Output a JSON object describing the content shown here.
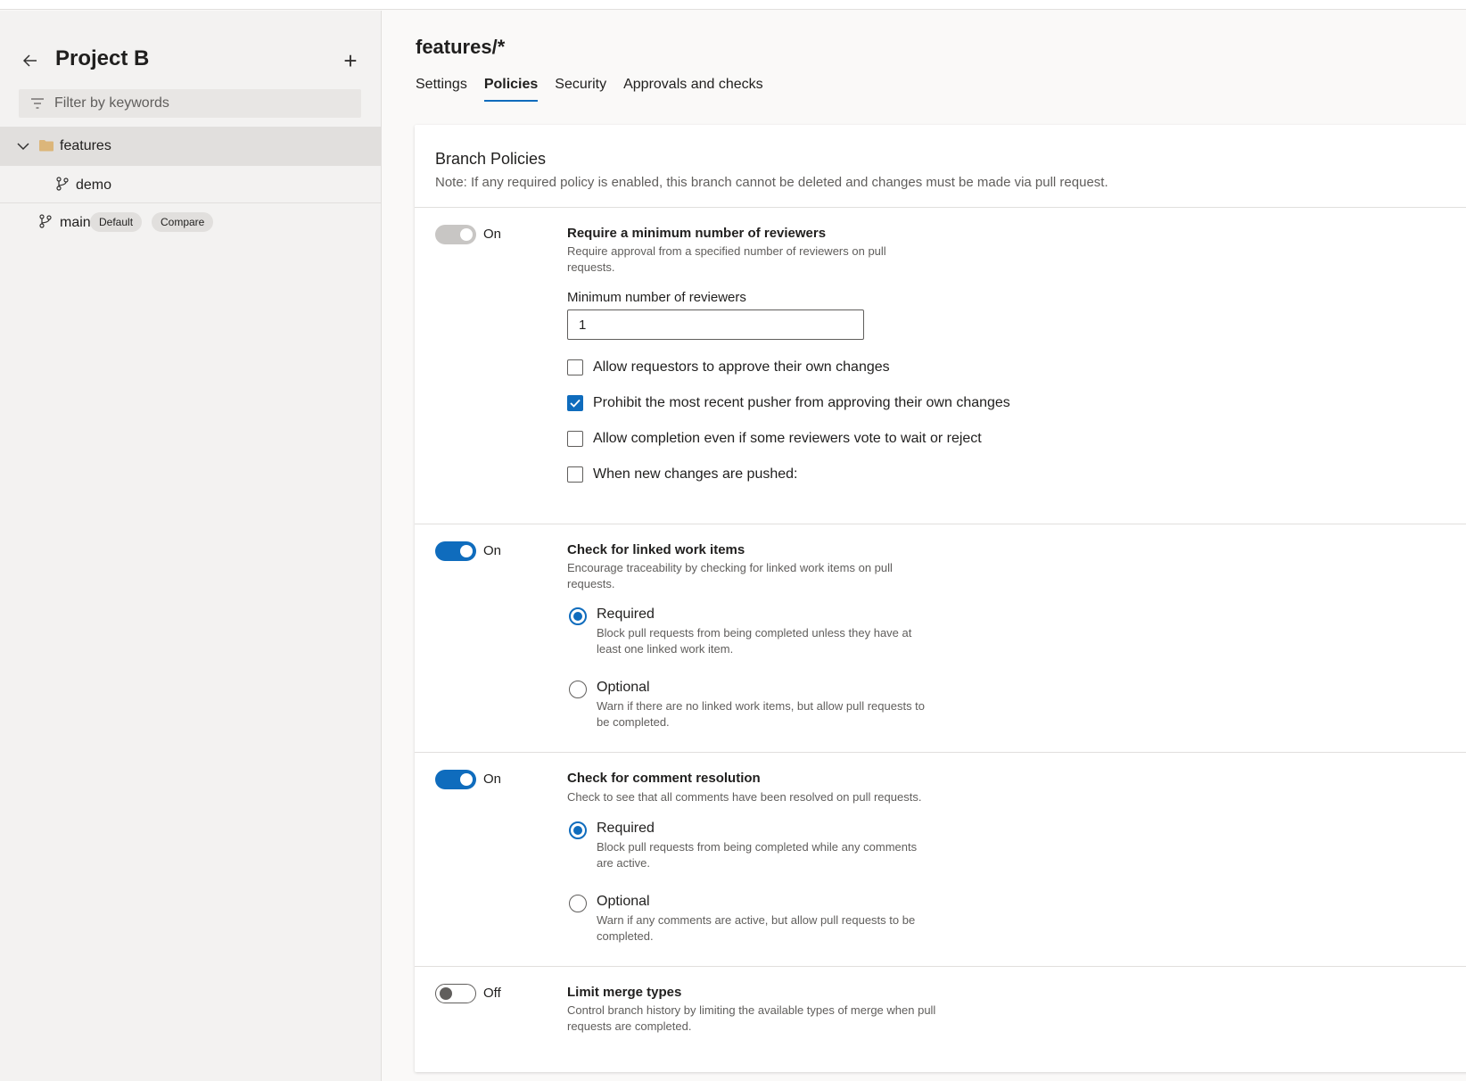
{
  "sidebar": {
    "project_title": "Project B",
    "filter_placeholder": "Filter by keywords",
    "tree": {
      "folder_label": "features",
      "child_label": "demo",
      "main_label": "main",
      "main_badges": {
        "default": "Default",
        "compare": "Compare"
      }
    }
  },
  "main": {
    "title": "features/*",
    "tabs": [
      {
        "label": "Settings",
        "active": false
      },
      {
        "label": "Policies",
        "active": true
      },
      {
        "label": "Security",
        "active": false
      },
      {
        "label": "Approvals and checks",
        "active": false
      }
    ],
    "branch_policies": {
      "title": "Branch Policies",
      "note": "Note: If any required policy is enabled, this branch cannot be deleted and changes must be made via pull request."
    },
    "policies": [
      {
        "state": "On",
        "title": "Require a minimum number of reviewers",
        "description": "Require approval from a specified number of reviewers on pull requests.",
        "min_reviewers_label": "Minimum number of reviewers",
        "min_reviewers_value": "1",
        "checkboxes": [
          {
            "label": "Allow requestors to approve their own changes",
            "checked": false
          },
          {
            "label": "Prohibit the most recent pusher from approving their own changes",
            "checked": true
          },
          {
            "label": "Allow completion even if some reviewers vote to wait or reject",
            "checked": false
          },
          {
            "label": "When new changes are pushed:",
            "checked": false
          }
        ]
      },
      {
        "state": "On",
        "title": "Check for linked work items",
        "description": "Encourage traceability by checking for linked work items on pull requests.",
        "options": [
          {
            "label": "Required",
            "description": "Block pull requests from being completed unless they have at least one linked work item.",
            "selected": true
          },
          {
            "label": "Optional",
            "description": "Warn if there are no linked work items, but allow pull requests to be completed.",
            "selected": false
          }
        ]
      },
      {
        "state": "On",
        "title": "Check for comment resolution",
        "description": "Check to see that all comments have been resolved on pull requests.",
        "options": [
          {
            "label": "Required",
            "description": "Block pull requests from being completed while any comments are active.",
            "selected": true
          },
          {
            "label": "Optional",
            "description": "Warn if any comments are active, but allow pull requests to be completed.",
            "selected": false
          }
        ]
      },
      {
        "state": "Off",
        "title": "Limit merge types",
        "description": "Control branch history by limiting the available types of merge when pull requests are completed."
      }
    ]
  },
  "colors": {
    "accent": "#0f6cbd",
    "folder": "#dcb67a"
  },
  "icons": [
    "back-arrow-icon",
    "plus-icon",
    "filter-icon",
    "chevron-down-icon",
    "folder-icon",
    "branch-icon",
    "checkmark-icon"
  ]
}
